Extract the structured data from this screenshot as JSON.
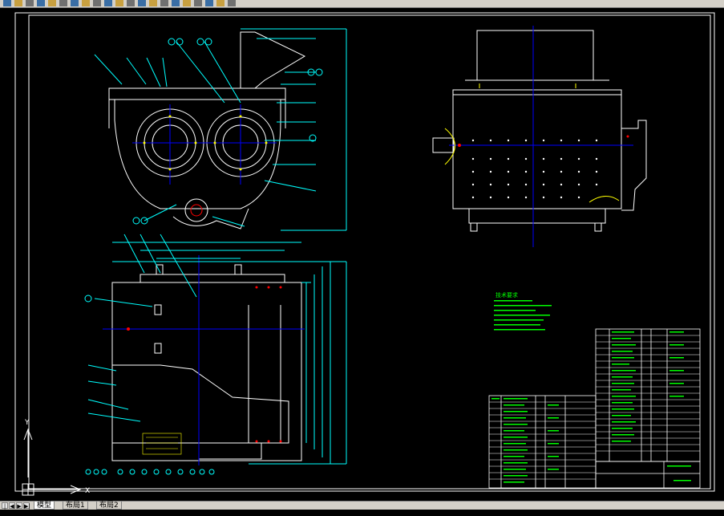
{
  "toolbar": {
    "icons": [
      "new-icon",
      "open-icon",
      "save-icon",
      "print-icon",
      "preview-icon",
      "cut-icon",
      "copy-icon",
      "paste-icon",
      "match-icon",
      "undo-icon",
      "redo-icon",
      "pan-icon",
      "zoom-icon",
      "zoom-window-icon",
      "zoom-previous-icon",
      "properties-icon",
      "design-center-icon",
      "tool-palette-icon",
      "sheet-set-icon",
      "markup-icon",
      "calculator-icon"
    ]
  },
  "drawing": {
    "notes_title": "技术要求",
    "ucs_x": "X",
    "ucs_y": "Y"
  },
  "tabs": {
    "nav": [
      "|◀",
      "◀",
      "▶",
      "▶|"
    ],
    "items": [
      "模型",
      "布局1",
      "布局2"
    ],
    "active": 0
  },
  "colors": {
    "background": "#000000",
    "frame": "#ffffff",
    "geometry": "#ffffff",
    "dimension": "#00ffff",
    "centerline": "#0000ff",
    "notes": "#00ff00",
    "detail": "#ffff00",
    "highlight": "#ff0000",
    "table": "#ffffff"
  }
}
